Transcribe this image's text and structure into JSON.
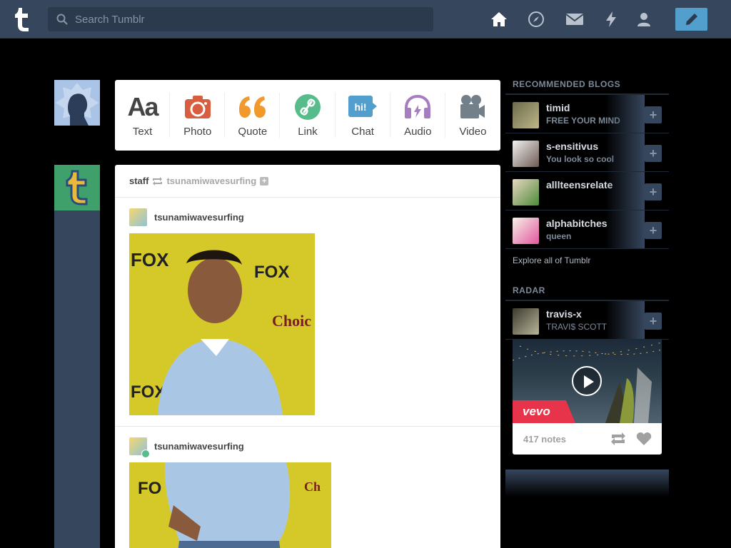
{
  "header": {
    "search_placeholder": "Search Tumblr",
    "nav": [
      "home-icon",
      "explore-icon",
      "inbox-icon",
      "activity-icon",
      "account-icon"
    ],
    "compose": "pencil-icon"
  },
  "composer": {
    "types": [
      {
        "label": "Text",
        "icon": "Aa",
        "color": "#444444"
      },
      {
        "label": "Photo",
        "icon": "camera-icon",
        "color": "#d95e40"
      },
      {
        "label": "Quote",
        "icon": "quote-icon",
        "color": "#f2992e"
      },
      {
        "label": "Link",
        "icon": "link-icon",
        "color": "#56bc8a"
      },
      {
        "label": "Chat",
        "icon": "hi!",
        "color": "#529ecc"
      },
      {
        "label": "Audio",
        "icon": "headphones-icon",
        "color": "#a77dc2"
      },
      {
        "label": "Video",
        "icon": "video-camera-icon",
        "color": "#748089"
      }
    ]
  },
  "post": {
    "poster": "staff",
    "reblogged_from": "tsunamiwavesurfing",
    "entries": [
      {
        "user": "tsunamiwavesurfing"
      },
      {
        "user": "tsunamiwavesurfing"
      }
    ]
  },
  "sidebar": {
    "recommended_title": "RECOMMENDED BLOGS",
    "blogs": [
      {
        "name": "timid",
        "title": "FREE YOUR MIND"
      },
      {
        "name": "s-ensitivus",
        "title": "You look so cool"
      },
      {
        "name": "alllteensrelate",
        "title": ""
      },
      {
        "name": "alphabitches",
        "title": "queen"
      }
    ],
    "explore": "Explore all of Tumblr",
    "radar_title": "RADAR",
    "radar": {
      "name": "travis-x",
      "title": "TRAVI$ SCOTT",
      "brand": "vevo",
      "notes": "417 notes"
    }
  }
}
